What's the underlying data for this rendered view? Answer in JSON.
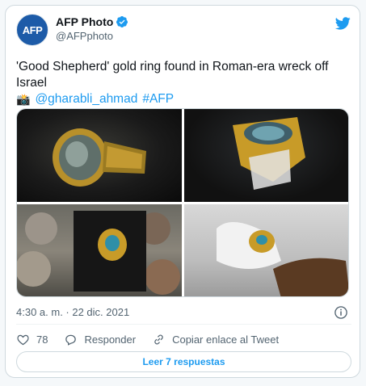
{
  "author": {
    "avatar_text": "AFP",
    "name": "AFP Photo",
    "handle": "@AFPphoto"
  },
  "tweet": {
    "text_line1": "'Good Shepherd' gold ring found in Roman-era wreck off Israel",
    "camera_emoji": "📸",
    "mention": "@gharabli_ahmad",
    "hashtag": "#AFP"
  },
  "media": {
    "images": [
      {
        "alt": "gold ring close-up"
      },
      {
        "alt": "gold ring on dark background"
      },
      {
        "alt": "gold ring with coins"
      },
      {
        "alt": "gloved hand holding ring"
      }
    ]
  },
  "meta": {
    "timestamp": "4:30 a. m. · 22 dic. 2021"
  },
  "actions": {
    "likes": "78",
    "reply_label": "Responder",
    "copy_label": "Copiar enlace al Tweet"
  },
  "replies_button": "Leer 7 respuestas",
  "colors": {
    "accent": "#1d9bf0",
    "like_color": "#536471",
    "afp_blue": "#1d5ba8"
  }
}
